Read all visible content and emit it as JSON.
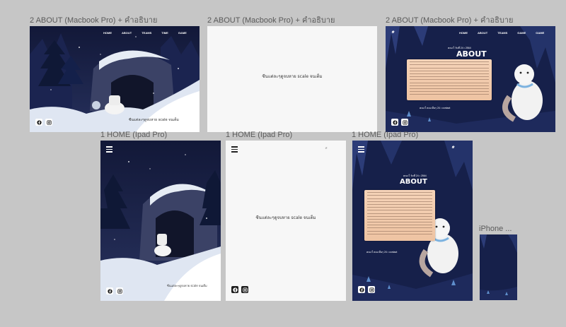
{
  "frames": {
    "about_mac_1": {
      "label": "2 ABOUT (Macbook Pro) + คำอธิบาย",
      "caption": "ซีนแต่ละๆดูจบหาย scale จนเต็ม",
      "nav": [
        "HOME",
        "ABOUT",
        "TEAMS",
        "TIME",
        "GAME"
      ]
    },
    "about_mac_2": {
      "label": "2 ABOUT (Macbook Pro) + คำอธิบาย",
      "caption": "ซีนแต่ละๆดูจบหาย scale จนเต็ม"
    },
    "about_mac_3": {
      "label": "2 ABOUT (Macbook Pro) + คำอธิบาย",
      "nav": [
        "HOME",
        "ABOUT",
        "TEAMS",
        "GAME",
        "GAME"
      ],
      "meta": "คณะใ วันที่ 24 • 2564",
      "title": "ABOUT",
      "credit": "คณะใ คณะอื่นๆ 24 • contact"
    },
    "home_ipad_1": {
      "label": "1 HOME (Ipad Pro)",
      "caption": "ซีนแต่ละๆดูจบหาย scale จนเต็ม"
    },
    "home_ipad_2": {
      "label": "1 HOME (Ipad Pro)",
      "caption": "ซีนแต่ละๆดูจบหาย scale จนเต็ม"
    },
    "home_ipad_3": {
      "label": "1 HOME (Ipad Pro)",
      "meta": "คณะใ วันที่ 24 • 2564",
      "title": "ABOUT",
      "credit": "คณะใ คณะอื่นๆ 24 • contact"
    },
    "iphone": {
      "label": "iPhone ..."
    }
  },
  "icons": [
    "facebook-icon",
    "instagram-icon",
    "menu-icon",
    "logo"
  ],
  "colors": {
    "canvas": "#c6c6c6",
    "night": "#141a3a",
    "paper": "#f0c7a6"
  }
}
